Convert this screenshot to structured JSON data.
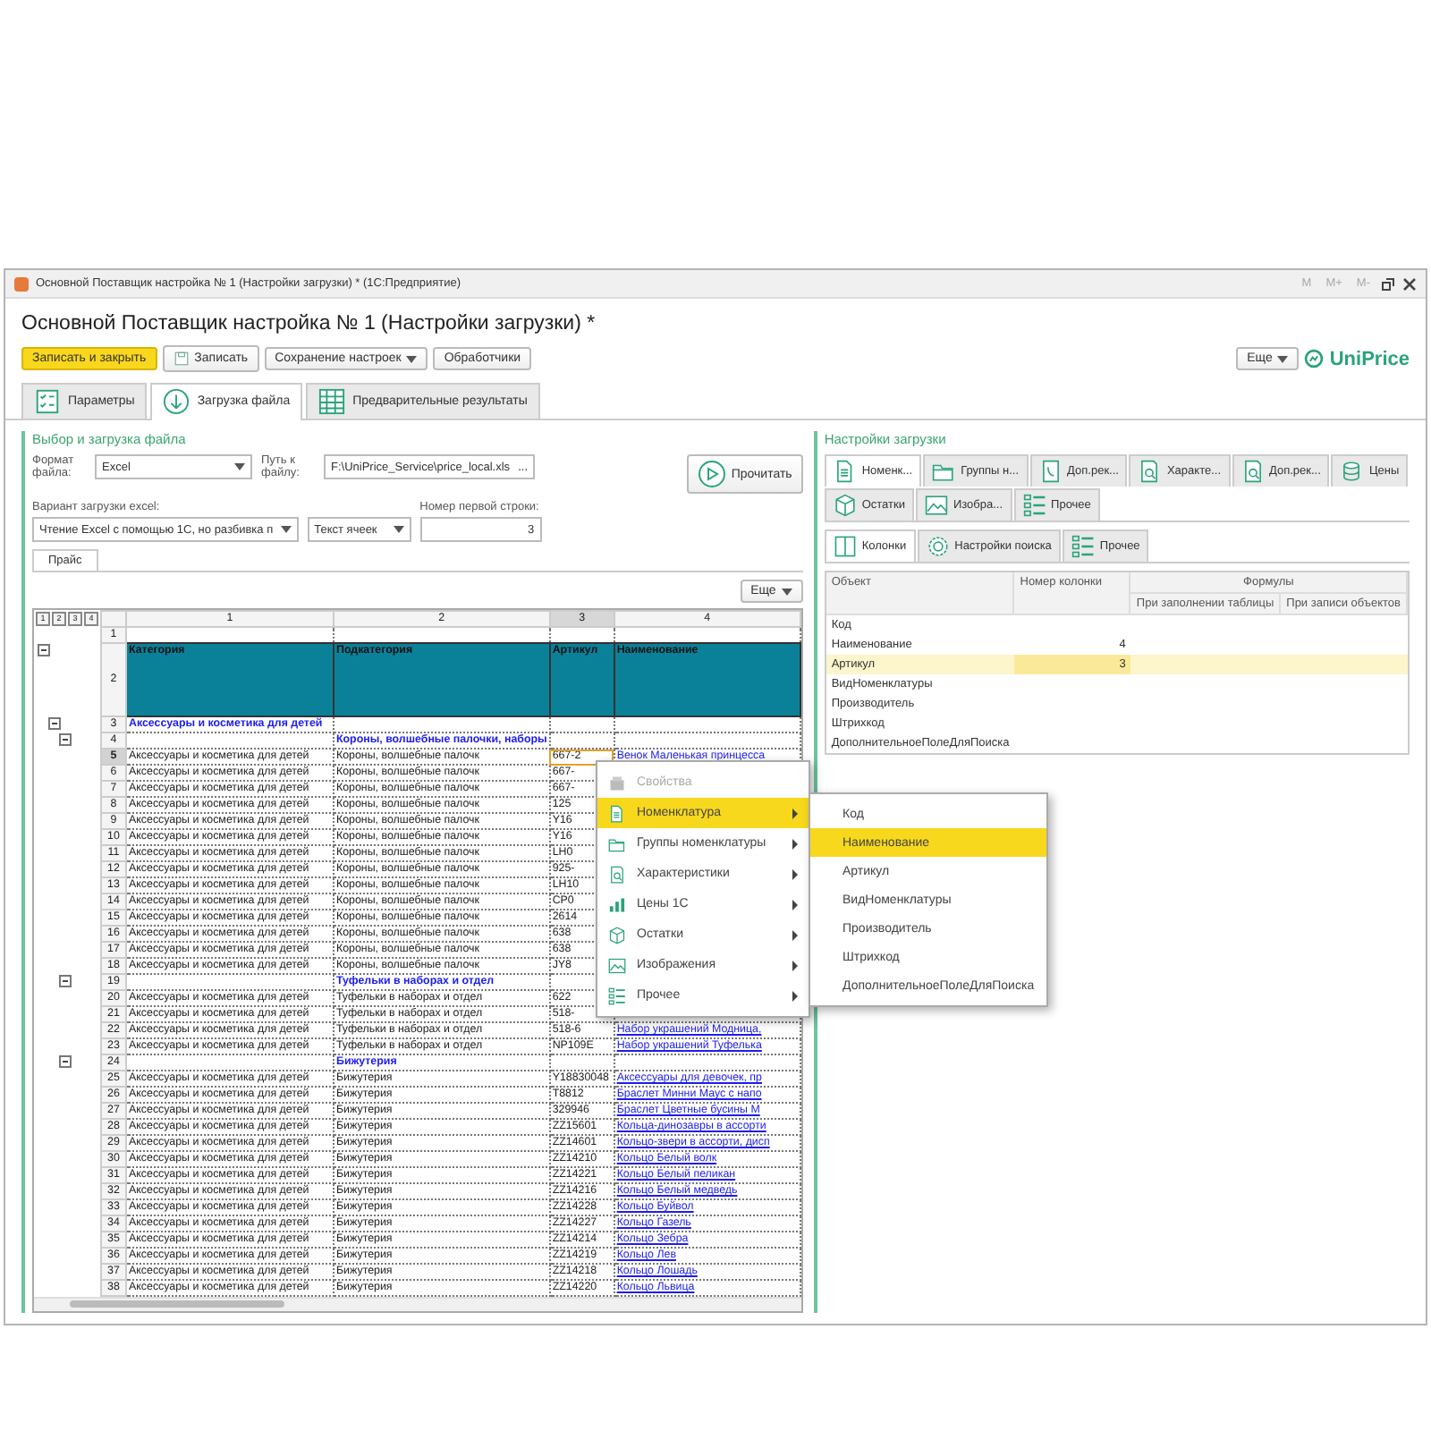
{
  "window": {
    "title": "Основной Поставщик настройка № 1 (Настройки загрузки) * (1С:Предприятие)",
    "memory_buttons": [
      "M",
      "M+",
      "M-"
    ]
  },
  "form": {
    "title": "Основной Поставщик настройка № 1 (Настройки загрузки) *"
  },
  "toolbar": {
    "buttons": [
      {
        "label": "Записать и закрыть",
        "kind": "primary"
      },
      {
        "label": "Записать",
        "kind": "icon"
      },
      {
        "label": "Сохранение настроек",
        "kind": "dropdown"
      },
      {
        "label": "Обработчики",
        "kind": "plain"
      }
    ],
    "more": "Еще",
    "logo": "UniPrice"
  },
  "tabs": [
    {
      "label": "Параметры",
      "selected": false
    },
    {
      "label": "Загрузка файла",
      "selected": true
    },
    {
      "label": "Предварительные результаты",
      "selected": false
    }
  ],
  "file_group": {
    "title": "Выбор и загрузка файла",
    "format_label": "Формат файла:",
    "format_value": "Excel",
    "path_label": "Путь к файлу:",
    "path_value": "F:\\UniPrice_Service\\price_local.xls",
    "browse": "...",
    "read_button": "Прочитать",
    "mode_label": "Вариант загрузки excel:",
    "mode_value": "Чтение Excel с помощью 1С, но разбивка п",
    "cell_mode_value": "Текст ячеек",
    "first_row_label": "Номер первой строки:",
    "first_row_value": "3",
    "sheet_tabs": [
      {
        "label": "Прайс",
        "selected": true
      }
    ],
    "more": "Еще"
  },
  "sheet": {
    "levels": [
      "1",
      "2",
      "3",
      "4"
    ],
    "columns": [
      {
        "label": "1",
        "selected": false
      },
      {
        "label": "2",
        "selected": false
      },
      {
        "label": "3",
        "selected": true
      },
      {
        "label": "4",
        "selected": false
      }
    ],
    "rows": [
      {
        "num": "1",
        "kind": "blank",
        "selected": false
      },
      {
        "num": "2",
        "kind": "header",
        "selected": false,
        "expanded": true,
        "cells": {
          "c1": "Категория",
          "c2": "Подкатегория",
          "c3": "Артикул",
          "c4": "Наименование"
        },
        "children": [
          {
            "num": "3",
            "kind": "group",
            "selected": false,
            "expanded": true,
            "cells": {
              "c1": "Аксессуары и косметика для детей"
            },
            "children": [
              {
                "num": "4",
                "kind": "group",
                "selected": false,
                "expanded": true,
                "cells": {
                  "c2": "Короны, волшебные палочки, наборы"
                },
                "children": [
                  {
                    "num": "5",
                    "kind": "item",
                    "selected": true,
                    "cells": {
                      "c1": "Аксессуары и косметика для детей",
                      "c2": "Короны, волшебные палочк",
                      "c3": "667-2",
                      "c4": "Венок Маленькая принцесса"
                    }
                  },
                  {
                    "num": "6",
                    "kind": "item",
                    "selected": false,
                    "cells": {
                      "c1": "Аксессуары и косметика для детей",
                      "c2": "Короны, волшебные палочк",
                      "c3": "667-"
                    }
                  },
                  {
                    "num": "7",
                    "kind": "item",
                    "selected": false,
                    "cells": {
                      "c1": "Аксессуары и косметика для детей",
                      "c2": "Короны, волшебные палочк",
                      "c3": "667-"
                    }
                  },
                  {
                    "num": "8",
                    "kind": "item",
                    "selected": false,
                    "cells": {
                      "c1": "Аксессуары и косметика для детей",
                      "c2": "Короны, волшебные палочк",
                      "c3": "125"
                    }
                  },
                  {
                    "num": "9",
                    "kind": "item",
                    "selected": false,
                    "cells": {
                      "c1": "Аксессуары и косметика для детей",
                      "c2": "Короны, волшебные палочк",
                      "c3": "Y16"
                    }
                  },
                  {
                    "num": "10",
                    "kind": "item",
                    "selected": false,
                    "cells": {
                      "c1": "Аксессуары и косметика для детей",
                      "c2": "Короны, волшебные палочк",
                      "c3": "Y16"
                    }
                  },
                  {
                    "num": "11",
                    "kind": "item",
                    "selected": false,
                    "cells": {
                      "c1": "Аксессуары и косметика для детей",
                      "c2": "Короны, волшебные палочк",
                      "c3": "LH0"
                    }
                  },
                  {
                    "num": "12",
                    "kind": "item",
                    "selected": false,
                    "cells": {
                      "c1": "Аксессуары и косметика для детей",
                      "c2": "Короны, волшебные палочк",
                      "c3": "925-"
                    }
                  },
                  {
                    "num": "13",
                    "kind": "item",
                    "selected": false,
                    "cells": {
                      "c1": "Аксессуары и косметика для детей",
                      "c2": "Короны, волшебные палочк",
                      "c3": "LH10"
                    }
                  },
                  {
                    "num": "14",
                    "kind": "item",
                    "selected": false,
                    "cells": {
                      "c1": "Аксессуары и косметика для детей",
                      "c2": "Короны, волшебные палочк",
                      "c3": "CP0"
                    }
                  },
                  {
                    "num": "15",
                    "kind": "item",
                    "selected": false,
                    "cells": {
                      "c1": "Аксессуары и косметика для детей",
                      "c2": "Короны, волшебные палочк",
                      "c3": "2614"
                    }
                  },
                  {
                    "num": "16",
                    "kind": "item",
                    "selected": false,
                    "cells": {
                      "c1": "Аксессуары и косметика для детей",
                      "c2": "Короны, волшебные палочк",
                      "c3": "638"
                    }
                  },
                  {
                    "num": "17",
                    "kind": "item",
                    "selected": false,
                    "cells": {
                      "c1": "Аксессуары и косметика для детей",
                      "c2": "Короны, волшебные палочк",
                      "c3": "638"
                    }
                  },
                  {
                    "num": "18",
                    "kind": "item",
                    "selected": false,
                    "cells": {
                      "c1": "Аксессуары и косметика для детей",
                      "c2": "Короны, волшебные палочк",
                      "c3": "JY8"
                    }
                  }
                ]
              },
              {
                "num": "19",
                "kind": "group",
                "selected": false,
                "expanded": true,
                "cells": {
                  "c2": "Туфельки в наборах и отдел"
                },
                "children": [
                  {
                    "num": "20",
                    "kind": "item",
                    "selected": false,
                    "cells": {
                      "c1": "Аксессуары и косметика для детей",
                      "c2": "Туфельки в наборах и отдел",
                      "c3": "622"
                    }
                  },
                  {
                    "num": "21",
                    "kind": "item",
                    "selected": false,
                    "cells": {
                      "c1": "Аксессуары и косметика для детей",
                      "c2": "Туфельки в наборах и отдел",
                      "c3": "518-"
                    }
                  },
                  {
                    "num": "22",
                    "kind": "item",
                    "selected": false,
                    "cells": {
                      "c1": "Аксессуары и косметика для детей",
                      "c2": "Туфельки в наборах и отдел",
                      "c3": "518-6",
                      "c4": "Набор украшений Модница,"
                    }
                  },
                  {
                    "num": "23",
                    "kind": "item",
                    "selected": false,
                    "cells": {
                      "c1": "Аксессуары и косметика для детей",
                      "c2": "Туфельки в наборах и отдел",
                      "c3": "NP109E",
                      "c4": "Набор украшений Туфелька"
                    }
                  }
                ]
              },
              {
                "num": "24",
                "kind": "group",
                "selected": false,
                "expanded": true,
                "cells": {
                  "c2": "Бижутерия"
                },
                "children": [
                  {
                    "num": "25",
                    "kind": "item",
                    "selected": false,
                    "cells": {
                      "c1": "Аксессуары и косметика для детей",
                      "c2": "Бижутерия",
                      "c3": "Y18830048",
                      "c4": "Аксессуары для девочек, пр"
                    }
                  },
                  {
                    "num": "26",
                    "kind": "item",
                    "selected": false,
                    "cells": {
                      "c1": "Аксессуары и косметика для детей",
                      "c2": "Бижутерия",
                      "c3": "T8812",
                      "c4": "Браслет Минни Маус с напо"
                    }
                  },
                  {
                    "num": "27",
                    "kind": "item",
                    "selected": false,
                    "cells": {
                      "c1": "Аксессуары и косметика для детей",
                      "c2": "Бижутерия",
                      "c3": "329946",
                      "c4": "Браслет Цветные бусины М"
                    }
                  },
                  {
                    "num": "28",
                    "kind": "item",
                    "selected": false,
                    "cells": {
                      "c1": "Аксессуары и косметика для детей",
                      "c2": "Бижутерия",
                      "c3": "ZZ15601",
                      "c4": "Кольца-динозавры в ассорти"
                    }
                  },
                  {
                    "num": "29",
                    "kind": "item",
                    "selected": false,
                    "cells": {
                      "c1": "Аксессуары и косметика для детей",
                      "c2": "Бижутерия",
                      "c3": "ZZ14601",
                      "c4": "Кольцо-звери в ассорти, дисп"
                    }
                  },
                  {
                    "num": "30",
                    "kind": "item",
                    "selected": false,
                    "cells": {
                      "c1": "Аксессуары и косметика для детей",
                      "c2": "Бижутерия",
                      "c3": "ZZ14210",
                      "c4": "Кольцо Белый волк"
                    }
                  },
                  {
                    "num": "31",
                    "kind": "item",
                    "selected": false,
                    "cells": {
                      "c1": "Аксессуары и косметика для детей",
                      "c2": "Бижутерия",
                      "c3": "ZZ14221",
                      "c4": "Кольцо Белый пеликан"
                    }
                  },
                  {
                    "num": "32",
                    "kind": "item",
                    "selected": false,
                    "cells": {
                      "c1": "Аксессуары и косметика для детей",
                      "c2": "Бижутерия",
                      "c3": "ZZ14216",
                      "c4": "Кольцо Белый медведь"
                    }
                  },
                  {
                    "num": "33",
                    "kind": "item",
                    "selected": false,
                    "cells": {
                      "c1": "Аксессуары и косметика для детей",
                      "c2": "Бижутерия",
                      "c3": "ZZ14228",
                      "c4": "Кольцо Буйвол"
                    }
                  },
                  {
                    "num": "34",
                    "kind": "item",
                    "selected": false,
                    "cells": {
                      "c1": "Аксессуары и косметика для детей",
                      "c2": "Бижутерия",
                      "c3": "ZZ14227",
                      "c4": "Кольцо Газель"
                    }
                  },
                  {
                    "num": "35",
                    "kind": "item",
                    "selected": false,
                    "cells": {
                      "c1": "Аксессуары и косметика для детей",
                      "c2": "Бижутерия",
                      "c3": "ZZ14214",
                      "c4": "Кольцо Зебра"
                    }
                  },
                  {
                    "num": "36",
                    "kind": "item",
                    "selected": false,
                    "cells": {
                      "c1": "Аксессуары и косметика для детей",
                      "c2": "Бижутерия",
                      "c3": "ZZ14219",
                      "c4": "Кольцо Лев"
                    }
                  },
                  {
                    "num": "37",
                    "kind": "item",
                    "selected": false,
                    "cells": {
                      "c1": "Аксессуары и косметика для детей",
                      "c2": "Бижутерия",
                      "c3": "ZZ14218",
                      "c4": "Кольцо Лошадь"
                    }
                  },
                  {
                    "num": "38",
                    "kind": "item",
                    "selected": false,
                    "cells": {
                      "c1": "Аксессуары и косметика для детей",
                      "c2": "Бижутерия",
                      "c3": "ZZ14220",
                      "c4": "Кольцо Львица"
                    }
                  }
                ]
              }
            ]
          }
        ]
      }
    ]
  },
  "context_menu": {
    "items": [
      {
        "label": "Свойства",
        "disabled": true,
        "has_submenu": false,
        "selected": false
      },
      {
        "label": "Номенклатура",
        "disabled": false,
        "has_submenu": true,
        "selected": true
      },
      {
        "label": "Группы номенклатуры",
        "disabled": false,
        "has_submenu": true,
        "selected": false
      },
      {
        "label": "Характеристики",
        "disabled": false,
        "has_submenu": true,
        "selected": false
      },
      {
        "label": "Цены 1С",
        "disabled": false,
        "has_submenu": true,
        "selected": false
      },
      {
        "label": "Остатки",
        "disabled": false,
        "has_submenu": true,
        "selected": false
      },
      {
        "label": "Изображения",
        "disabled": false,
        "has_submenu": true,
        "selected": false
      },
      {
        "label": "Прочее",
        "disabled": false,
        "has_submenu": true,
        "selected": false
      }
    ],
    "submenu": [
      {
        "label": "Код",
        "selected": false
      },
      {
        "label": "Наименование",
        "selected": true
      },
      {
        "label": "Артикул",
        "selected": false
      },
      {
        "label": "ВидНоменклатуры",
        "selected": false
      },
      {
        "label": "Производитель",
        "selected": false
      },
      {
        "label": "Штрихкод",
        "selected": false
      },
      {
        "label": "ДополнительноеПолеДляПоиска",
        "selected": false
      }
    ]
  },
  "settings_group": {
    "title": "Настройки загрузки",
    "tabs": [
      {
        "label": "Номенк...",
        "selected": true
      },
      {
        "label": "Группы н...",
        "selected": false
      },
      {
        "label": "Доп.рек...",
        "selected": false
      },
      {
        "label": "Характе...",
        "selected": false
      },
      {
        "label": "Доп.рек...",
        "selected": false
      },
      {
        "label": "Цены",
        "selected": false
      },
      {
        "label": "Остатки",
        "selected": false
      },
      {
        "label": "Изобра...",
        "selected": false
      },
      {
        "label": "Прочее",
        "selected": false
      }
    ],
    "subtabs": [
      {
        "label": "Колонки",
        "selected": true
      },
      {
        "label": "Настройки поиска",
        "selected": false
      },
      {
        "label": "Прочее",
        "selected": false
      }
    ],
    "table": {
      "columns": [
        "Объект",
        "Номер колонки"
      ],
      "formulas": "Формулы",
      "formula_columns": [
        "При заполнении таблицы",
        "При записи объектов"
      ],
      "rows": [
        {
          "object": "Код",
          "selected": false
        },
        {
          "object": "Наименование",
          "column": "4",
          "selected": false
        },
        {
          "object": "Артикул",
          "column": "3",
          "selected": true
        },
        {
          "object": "ВидНоменклатуры",
          "selected": false
        },
        {
          "object": "Производитель",
          "selected": false
        },
        {
          "object": "Штрихкод",
          "selected": false
        },
        {
          "object": "ДополнительноеПолеДляПоиска",
          "selected": false
        }
      ]
    }
  }
}
